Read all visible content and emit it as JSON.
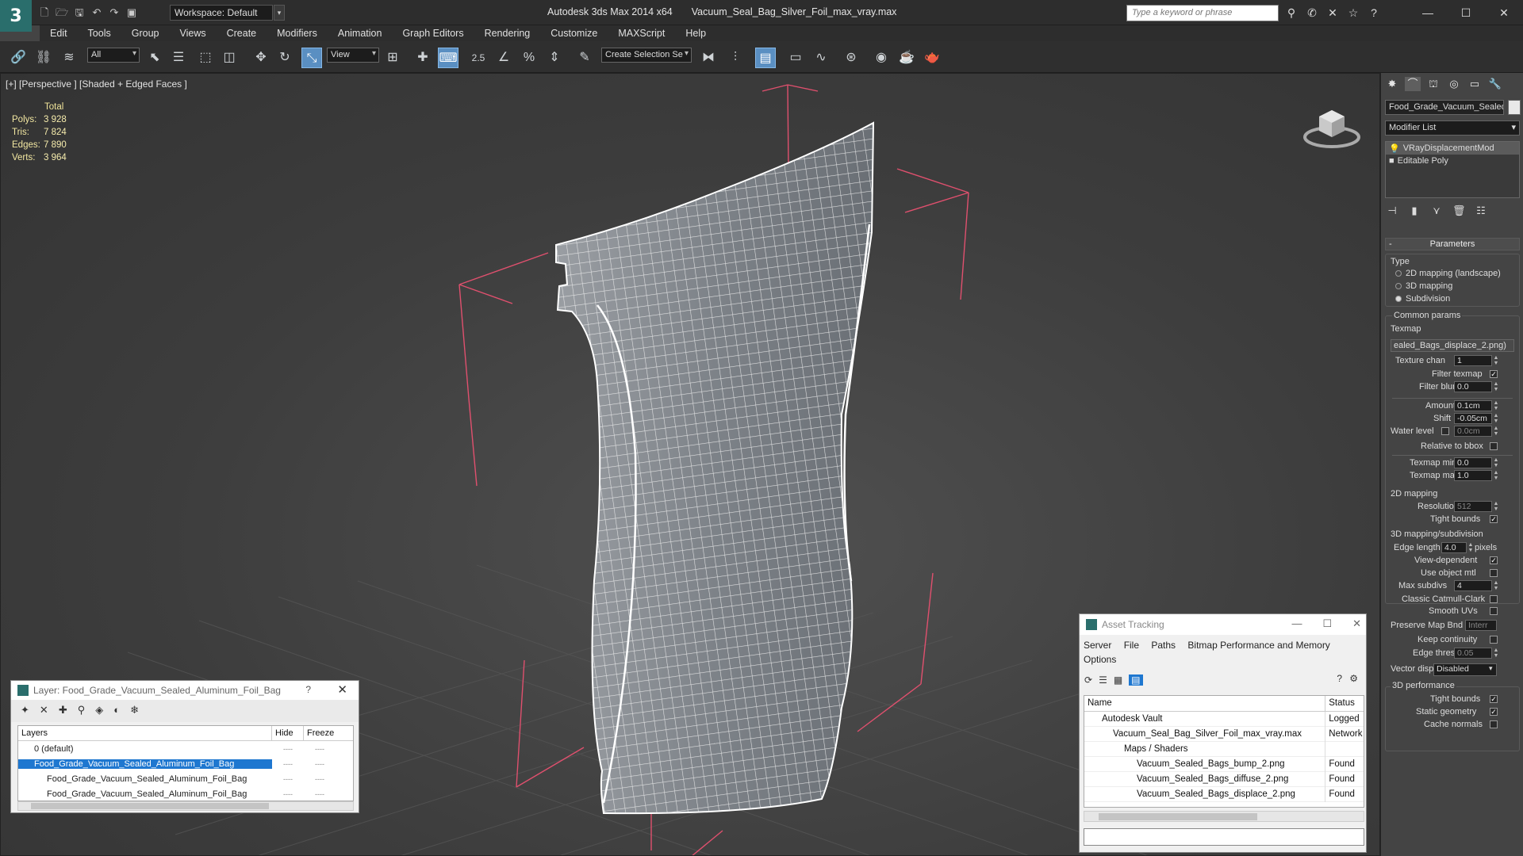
{
  "app": {
    "logo": "3",
    "workspace": "Workspace: Default",
    "title": "Autodesk 3ds Max  2014 x64",
    "file": "Vacuum_Seal_Bag_Silver_Foil_max_vray.max",
    "search_placeholder": "Type a keyword or phrase"
  },
  "menu": [
    "Edit",
    "Tools",
    "Group",
    "Views",
    "Create",
    "Modifiers",
    "Animation",
    "Graph Editors",
    "Rendering",
    "Customize",
    "MAXScript",
    "Help"
  ],
  "toolbar": {
    "filter": "All",
    "ref_coord": "View",
    "selection_set": "Create Selection Se",
    "snap_label": "2.5"
  },
  "viewport": {
    "label": "[+] [Perspective ] [Shaded + Edged Faces ]",
    "stats_header": "Total",
    "stats": [
      {
        "k": "Polys:",
        "v": "3 928"
      },
      {
        "k": "Tris:",
        "v": "7 824"
      },
      {
        "k": "Edges:",
        "v": "7 890"
      },
      {
        "k": "Verts:",
        "v": "3 964"
      }
    ]
  },
  "command_panel": {
    "object_name": "Food_Grade_Vacuum_Sealed",
    "modifier_list": "Modifier List",
    "stack": [
      "VRayDisplacementMod",
      "Editable Poly"
    ],
    "params_title": "Parameters",
    "type_label": "Type",
    "types": [
      "2D mapping (landscape)",
      "3D mapping",
      "Subdivision"
    ],
    "common_params": "Common params",
    "texmap_label": "Texmap",
    "texmap_value": "ealed_Bags_displace_2.png)",
    "texture_chan_label": "Texture chan",
    "texture_chan": "1",
    "filter_texmap": "Filter texmap",
    "filter_blur_label": "Filter blur",
    "filter_blur": "0.0",
    "amount_label": "Amount",
    "amount": "0.1cm",
    "shift_label": "Shift",
    "shift": "-0.05cm",
    "water_level_label": "Water level",
    "water_level": "0.0cm",
    "relative_bbox": "Relative to bbox",
    "texmap_min_label": "Texmap min",
    "texmap_min": "0.0",
    "texmap_max_label": "Texmap max",
    "texmap_max": "1.0",
    "mapping2d": "2D mapping",
    "resolution_label": "Resolution",
    "resolution": "512",
    "tight_bounds": "Tight bounds",
    "mapping3d": "3D mapping/subdivision",
    "edge_length_label": "Edge length",
    "edge_length": "4.0",
    "pixels": "pixels",
    "view_dependent": "View-dependent",
    "use_object_mtl": "Use object mtl",
    "max_subdivs_label": "Max subdivs",
    "max_subdivs": "4",
    "classic_cc": "Classic Catmull-Clark",
    "smooth_uvs": "Smooth UVs",
    "preserve_map_bnd": "Preserve Map Bnd",
    "preserve_map_val": "Interr",
    "keep_continuity": "Keep continuity",
    "edge_thresh_label": "Edge thresh",
    "edge_thresh": "0.05",
    "vector_displ_label": "Vector displ",
    "vector_displ": "Disabled",
    "perf_title": "3D performance",
    "perf_tight_bounds": "Tight bounds",
    "static_geometry": "Static geometry",
    "cache_normals": "Cache normals"
  },
  "layer_window": {
    "title": "Layer: Food_Grade_Vacuum_Sealed_Aluminum_Foil_Bag",
    "help": "?",
    "col_layers": "Layers",
    "col_hide": "Hide",
    "col_freeze": "Freeze",
    "rows": [
      {
        "name": "0 (default)",
        "hide": "----",
        "freeze": "----"
      },
      {
        "name": "Food_Grade_Vacuum_Sealed_Aluminum_Foil_Bag",
        "hide": "----",
        "freeze": "----"
      },
      {
        "name": "Food_Grade_Vacuum_Sealed_Aluminum_Foil_Bag",
        "hide": "----",
        "freeze": "----"
      },
      {
        "name": "Food_Grade_Vacuum_Sealed_Aluminum_Foil_Bag",
        "hide": "----",
        "freeze": "----"
      }
    ]
  },
  "asset_tracking": {
    "title": "Asset Tracking",
    "menu": [
      "Server",
      "File",
      "Paths",
      "Bitmap Performance and Memory"
    ],
    "options": "Options",
    "col_name": "Name",
    "col_status": "Status",
    "rows": [
      {
        "name": "Autodesk Vault",
        "status": "Logged",
        "indent": 1
      },
      {
        "name": "Vacuum_Seal_Bag_Silver_Foil_max_vray.max",
        "status": "Network",
        "indent": 2
      },
      {
        "name": "Maps / Shaders",
        "status": "",
        "indent": 3
      },
      {
        "name": "Vacuum_Sealed_Bags_bump_2.png",
        "status": "Found",
        "indent": 4
      },
      {
        "name": "Vacuum_Sealed_Bags_diffuse_2.png",
        "status": "Found",
        "indent": 4
      },
      {
        "name": "Vacuum_Sealed_Bags_displace_2.png",
        "status": "Found",
        "indent": 4
      }
    ]
  }
}
